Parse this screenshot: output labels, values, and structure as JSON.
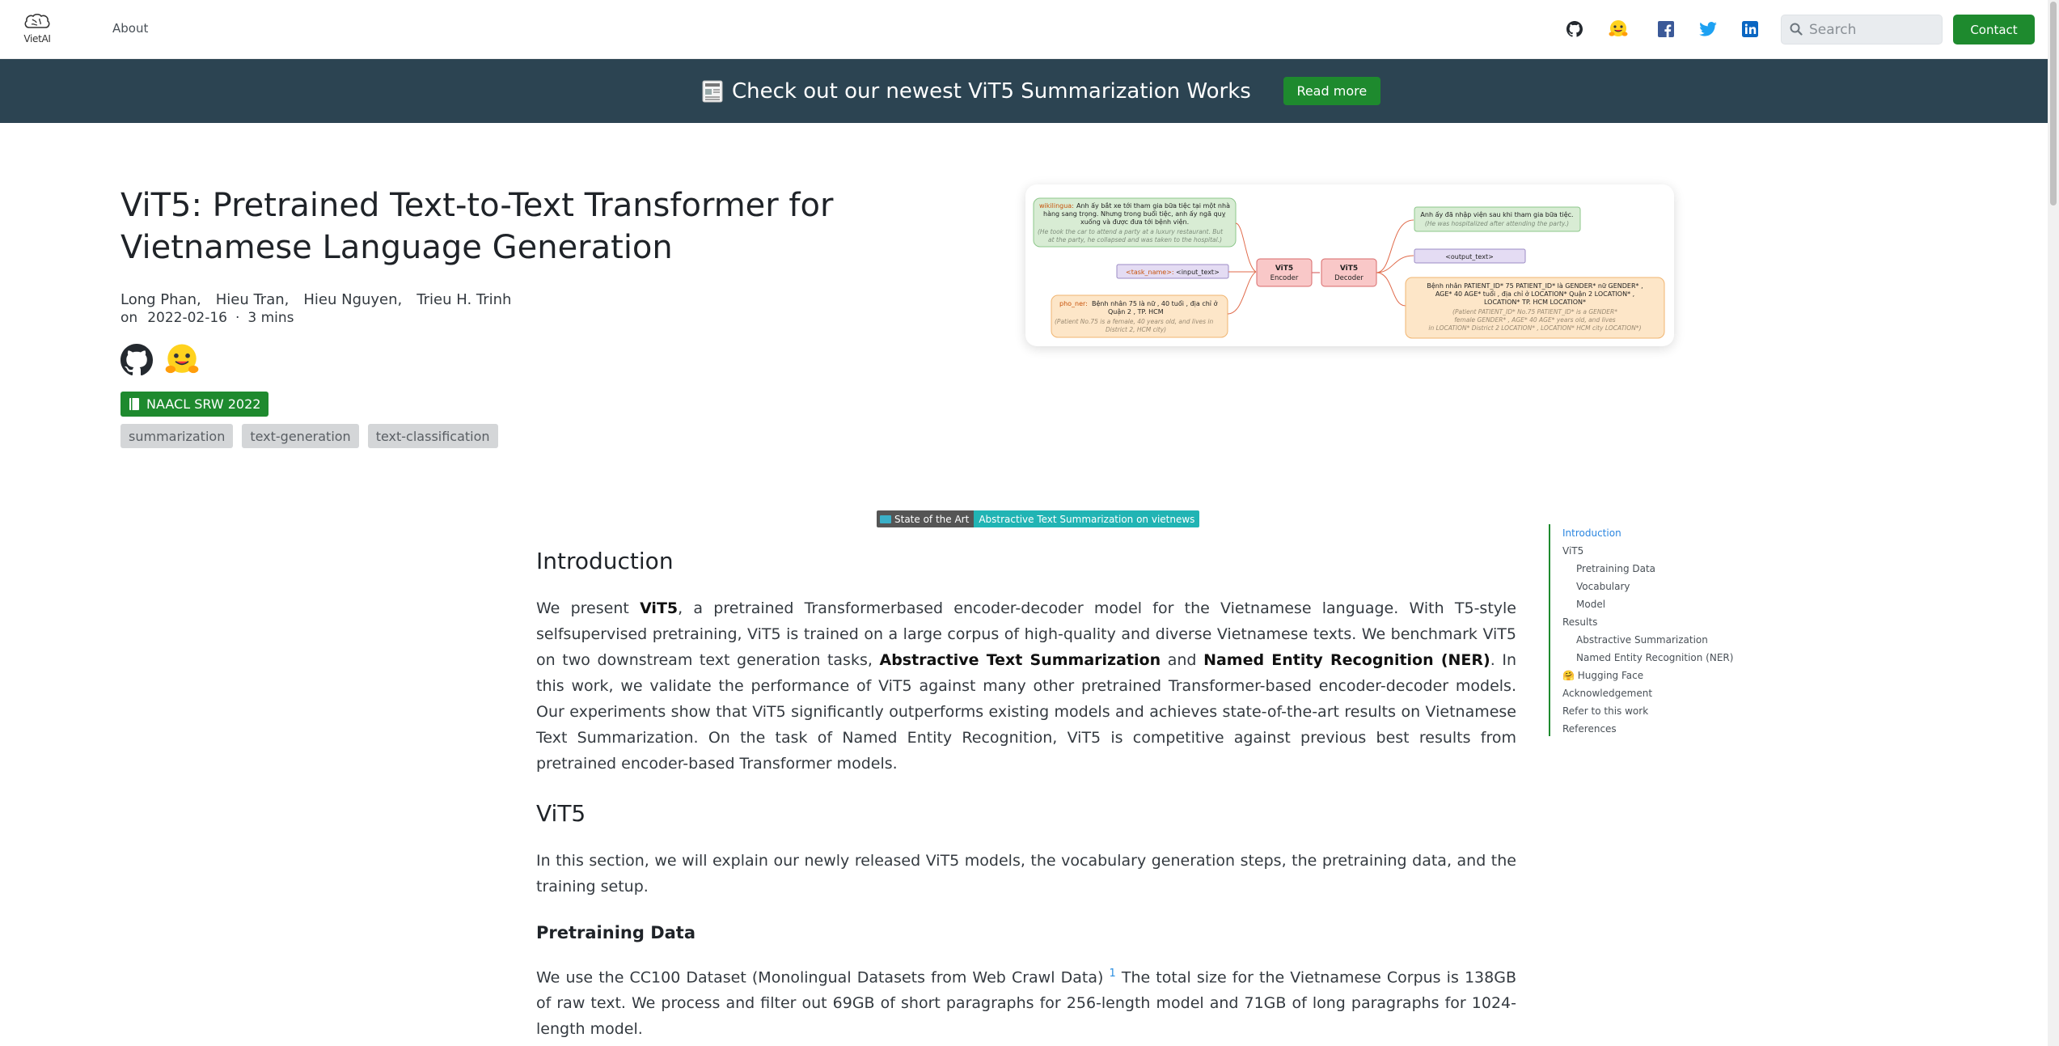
{
  "nav": {
    "logo_text": "VietAI",
    "about": "About",
    "search_placeholder": "Search",
    "contact": "Contact",
    "icons": [
      "github-icon",
      "huggingface-icon",
      "facebook-icon",
      "twitter-icon",
      "linkedin-icon"
    ]
  },
  "banner": {
    "text": "Check out our newest ViT5 Summarization Works",
    "button": "Read more"
  },
  "post": {
    "title": "ViT5: Pretrained Text-to-Text Transformer for Vietnamese Language Generation",
    "authors": [
      "Long Phan,",
      "Hieu Tran,",
      "Hieu Nguyen,",
      "Trieu H. Trinh"
    ],
    "on": "on",
    "date": "2022-02-16",
    "dot": "·",
    "read_time": "3 mins",
    "badge": "NAACL SRW 2022",
    "tags": [
      "summarization",
      "text-generation",
      "text-classification"
    ]
  },
  "diagram": {
    "wikilingua_label": "wikilingua:",
    "wikilingua_text1": "Anh ấy bắt xe tới tham gia bữa tiệc tại một nhà",
    "wikilingua_text2": "hàng sang trọng. Nhưng trong buổi tiệc, anh ấy ngã quỵ",
    "wikilingua_text3": "xuống và được đưa tới bệnh viện.",
    "wikilingua_en1": "(He took the car to attend a party at a luxury restaurant. But",
    "wikilingua_en2": "at the party, he collapsed and was taken to the hospital.)",
    "task_name": "<task_name>:",
    "input_text": "<input_text>",
    "phoner_label": "pho_ner:",
    "phoner_text1": "Bệnh nhân 75 là nữ , 40 tuổi , địa chỉ ở",
    "phoner_text2": "Quận 2 , TP. HCM",
    "phoner_en1": "(Patient No.75 is a female, 40 years old, and lives in",
    "phoner_en2": "District 2, HCM city)",
    "encoder1": "ViT5",
    "encoder2": "Encoder",
    "decoder1": "ViT5",
    "decoder2": "Decoder",
    "out1_text": "Anh ấy đã nhập viện sau khi tham gia bữa tiệc.",
    "out1_en": "(He was hospitalized after attending the party.)",
    "output_text": "<output_text>",
    "out3_text1": "Bệnh nhân PATIENT_ID* 75 PATIENT_ID* là GENDER* nữ GENDER* ,",
    "out3_text2": "AGE* 40 AGE* tuổi , địa chỉ ở LOCATION* Quận 2 LOCATION* ,",
    "out3_text3": "LOCATION* TP. HCM LOCATION*",
    "out3_en1": "(Patient PATIENT_ID* No.75 PATIENT_ID* is a GENDER*",
    "out3_en2": "female GENDER* , AGE* 40 AGE* years old, and lives",
    "out3_en3": "in LOCATION* District 2 LOCATION* , LOCATION* HCM city LOCATION*)"
  },
  "sota": {
    "left": "State of the Art",
    "right": "Abstractive Text Summarization on vietnews"
  },
  "content": {
    "intro_heading": "Introduction",
    "intro_p1_a": "We present ",
    "intro_p1_vit5": "ViT5",
    "intro_p1_b": ", a pretrained Transformerbased encoder-decoder model for the Vietnamese language. With T5-style selfsupervised pretraining, ViT5 is trained on a large corpus of high-quality and diverse Vietnamese texts. We benchmark ViT5 on two downstream text generation tasks, ",
    "intro_p1_ats": "Abstractive Text Summarization",
    "intro_p1_and": " and ",
    "intro_p1_ner": "Named Entity Recognition (NER)",
    "intro_p1_c": ". In this work, we validate the performance of ViT5 against many other pretrained Transformer-based encoder-decoder models. Our experiments show that ViT5 significantly outperforms existing models and achieves state-of-the-art results on Vietnamese Text Summarization. On the task of Named Entity Recognition, ViT5 is competitive against previous best results from pretrained encoder-based Transformer models.",
    "vit5_heading": "ViT5",
    "vit5_p": "In this section, we will explain our newly released ViT5 models, the vocabulary generation steps, the pretraining data, and the training setup.",
    "pretrain_heading": "Pretraining Data",
    "pretrain_p_a": "We use the CC100 Dataset (Monolingual Datasets from Web Crawl Data) ",
    "pretrain_sup": "1",
    "pretrain_p_b": " The total size for the Vietnamese Corpus is 138GB of raw text. We process and filter out 69GB of short paragraphs for 256-length model and 71GB of long paragraphs for 1024-length model."
  },
  "toc": [
    {
      "label": "Introduction",
      "level": 1,
      "active": true
    },
    {
      "label": "ViT5",
      "level": 1
    },
    {
      "label": "Pretraining Data",
      "level": 2
    },
    {
      "label": "Vocabulary",
      "level": 2
    },
    {
      "label": "Model",
      "level": 2
    },
    {
      "label": "Results",
      "level": 1
    },
    {
      "label": "Abstractive Summarization",
      "level": 2
    },
    {
      "label": "Named Entity Recognition (NER)",
      "level": 2
    },
    {
      "label": "🤗 Hugging Face",
      "level": 1
    },
    {
      "label": "Acknowledgement",
      "level": 1
    },
    {
      "label": "Refer to this work",
      "level": 1
    },
    {
      "label": "References",
      "level": 1
    }
  ],
  "colors": {
    "brand_green": "#1e8a2e",
    "banner_bg": "#2c4452",
    "toc_active": "#2b86e0"
  }
}
